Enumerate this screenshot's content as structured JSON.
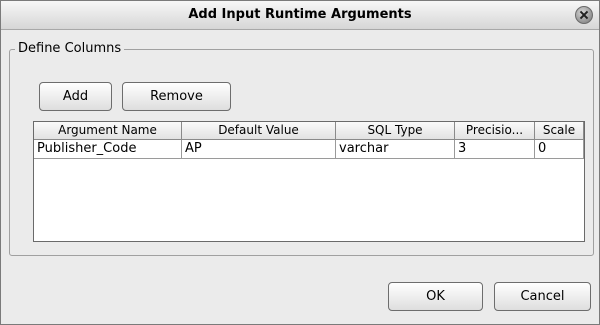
{
  "dialog": {
    "title": "Add Input Runtime Arguments"
  },
  "group": {
    "label": "Define Columns"
  },
  "toolbar": {
    "add_label": "Add",
    "remove_label": "Remove"
  },
  "table": {
    "columns": [
      "Argument Name",
      "Default Value",
      "SQL Type",
      "Precisio...",
      "Scale"
    ],
    "rows": [
      [
        "Publisher_Code",
        "AP",
        "varchar",
        "3",
        "0"
      ]
    ]
  },
  "footer": {
    "ok_label": "OK",
    "cancel_label": "Cancel"
  }
}
